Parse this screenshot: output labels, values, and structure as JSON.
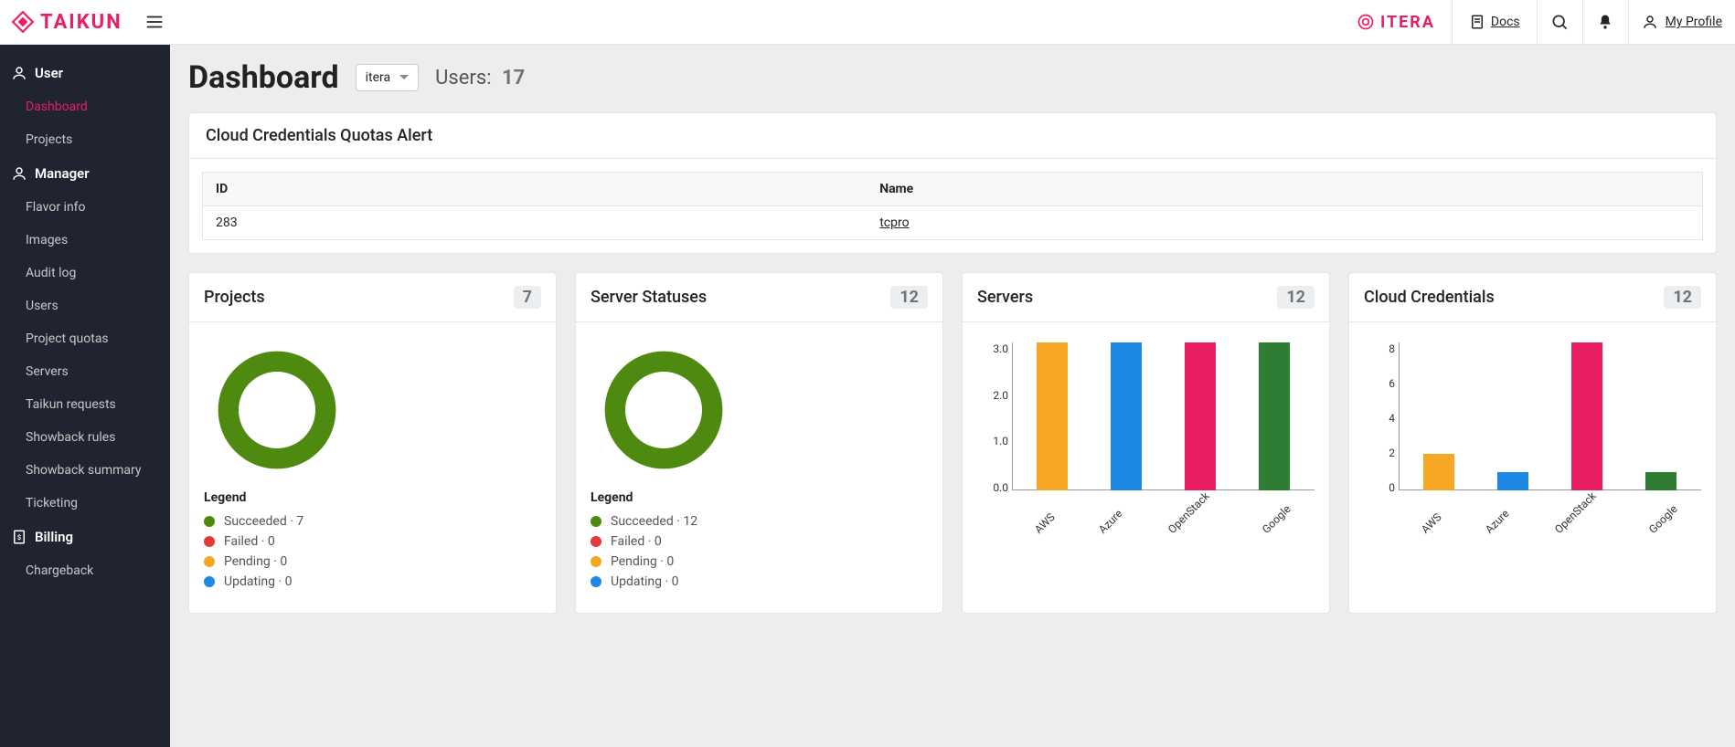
{
  "brand": "TAIKUN",
  "org_brand": "ITERA",
  "topbar": {
    "docs": "Docs",
    "profile": "My Profile"
  },
  "sidebar": {
    "sections": [
      {
        "label": "User",
        "items": [
          "Dashboard",
          "Projects"
        ]
      },
      {
        "label": "Manager",
        "items": [
          "Flavor info",
          "Images",
          "Audit log",
          "Users",
          "Project quotas",
          "Servers",
          "Taikun requests",
          "Showback rules",
          "Showback summary",
          "Ticketing"
        ]
      },
      {
        "label": "Billing",
        "items": [
          "Chargeback"
        ]
      }
    ],
    "active": "Dashboard"
  },
  "page": {
    "title": "Dashboard",
    "org_select": "itera",
    "users_label": "Users:",
    "users_count": "17"
  },
  "alert_card": {
    "title": "Cloud Credentials Quotas Alert",
    "columns": [
      "ID",
      "Name"
    ],
    "rows": [
      {
        "id": "283",
        "name": "tcpro"
      }
    ]
  },
  "tiles": {
    "projects": {
      "title": "Projects",
      "count": "7",
      "legend_title": "Legend",
      "legend": [
        {
          "color": "#4f8a10",
          "label": "Succeeded · 7"
        },
        {
          "color": "#e53935",
          "label": "Failed · 0"
        },
        {
          "color": "#f5a623",
          "label": "Pending · 0"
        },
        {
          "color": "#1e88e5",
          "label": "Updating · 0"
        }
      ]
    },
    "server_statuses": {
      "title": "Server Statuses",
      "count": "12",
      "legend_title": "Legend",
      "legend": [
        {
          "color": "#4f8a10",
          "label": "Succeeded · 12"
        },
        {
          "color": "#e53935",
          "label": "Failed · 0"
        },
        {
          "color": "#f5a623",
          "label": "Pending · 0"
        },
        {
          "color": "#1e88e5",
          "label": "Updating · 0"
        }
      ]
    },
    "servers": {
      "title": "Servers",
      "count": "12"
    },
    "cloud_creds": {
      "title": "Cloud Credentials",
      "count": "12"
    }
  },
  "chart_data": [
    {
      "id": "servers",
      "type": "bar",
      "title": "Servers",
      "categories": [
        "AWS",
        "Azure",
        "OpenStack",
        "Google"
      ],
      "values": [
        3,
        3,
        3,
        3
      ],
      "colors": [
        "#f5a623",
        "#1e88e5",
        "#e91e63",
        "#2e7d32"
      ],
      "ylim": [
        0,
        3
      ],
      "yticks": [
        "3.0",
        "2.0",
        "1.0",
        "0.0"
      ]
    },
    {
      "id": "cloud_credentials",
      "type": "bar",
      "title": "Cloud Credentials",
      "categories": [
        "AWS",
        "Azure",
        "OpenStack",
        "Google"
      ],
      "values": [
        2,
        1,
        8,
        1
      ],
      "colors": [
        "#f5a623",
        "#1e88e5",
        "#e91e63",
        "#2e7d32"
      ],
      "ylim": [
        0,
        8
      ],
      "yticks": [
        "8",
        "6",
        "4",
        "2",
        "0"
      ]
    },
    {
      "id": "projects_donut",
      "type": "pie",
      "title": "Projects",
      "series": [
        {
          "name": "Succeeded",
          "value": 7,
          "color": "#4f8a10"
        },
        {
          "name": "Failed",
          "value": 0,
          "color": "#e53935"
        },
        {
          "name": "Pending",
          "value": 0,
          "color": "#f5a623"
        },
        {
          "name": "Updating",
          "value": 0,
          "color": "#1e88e5"
        }
      ]
    },
    {
      "id": "server_statuses_donut",
      "type": "pie",
      "title": "Server Statuses",
      "series": [
        {
          "name": "Succeeded",
          "value": 12,
          "color": "#4f8a10"
        },
        {
          "name": "Failed",
          "value": 0,
          "color": "#e53935"
        },
        {
          "name": "Pending",
          "value": 0,
          "color": "#f5a623"
        },
        {
          "name": "Updating",
          "value": 0,
          "color": "#1e88e5"
        }
      ]
    }
  ]
}
